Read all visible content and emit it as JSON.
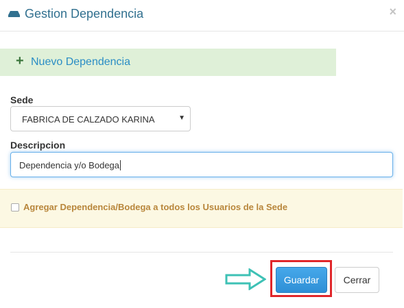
{
  "header": {
    "icon": "hdd-icon",
    "title": "Gestion Dependencia",
    "close_label": "×"
  },
  "new_bar": {
    "plus_label": "+",
    "label": "Nuevo Dependencia"
  },
  "form": {
    "sede_label": "Sede",
    "sede_value": "FABRICA DE CALZADO KARINA",
    "sede_caret": "▼",
    "descripcion_label": "Descripcion",
    "descripcion_value": "Dependencia y/o Bodega"
  },
  "warning": {
    "checkbox_checked": false,
    "label": "Agregar Dependencia/Bodega a todos los Usuarios de la Sede"
  },
  "footer": {
    "guardar_label": "Guardar",
    "cerrar_label": "Cerrar"
  },
  "colors": {
    "title": "#31708f",
    "success_bg": "#dff0d8",
    "warning_bg": "#fcf8e3",
    "warning_text": "#b8863b",
    "primary": "#2f8fd6",
    "highlight": "#e0262a",
    "arrow": "#3ec1b5"
  }
}
